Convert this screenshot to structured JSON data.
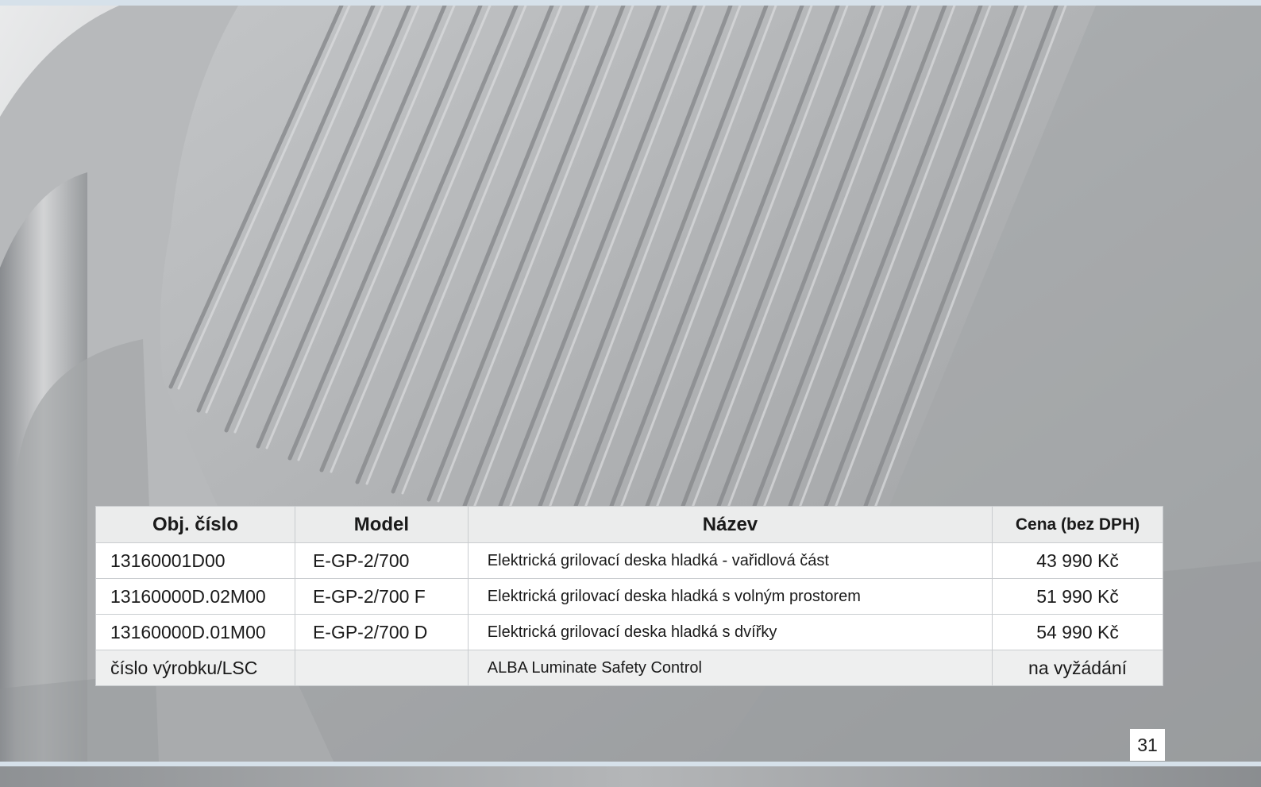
{
  "table": {
    "headers": {
      "code": "Obj. číslo",
      "model": "Model",
      "name": "Název",
      "price": "Cena (bez DPH)"
    },
    "rows": [
      {
        "code": "13160001D00",
        "model": "E-GP-2/700",
        "name": "Elektrická grilovací deska hladká - vařidlová část",
        "price": "43 990 Kč"
      },
      {
        "code": "13160000D.02M00",
        "model": "E-GP-2/700 F",
        "name": "Elektrická grilovací deska hladká s volným prostorem",
        "price": "51 990 Kč"
      },
      {
        "code": "13160000D.01M00",
        "model": "E-GP-2/700 D",
        "name": "Elektrická grilovací deska hladká s dvířky",
        "price": "54 990 Kč"
      },
      {
        "code": "číslo výrobku/LSC",
        "model": "",
        "name": "ALBA Luminate Safety Control",
        "price": "na vyžádání"
      }
    ]
  },
  "page_number": "31",
  "colors": {
    "rule_blue": "#d6e1ea",
    "header_bg": "#ebecec",
    "cell_bg": "#ffffff"
  }
}
